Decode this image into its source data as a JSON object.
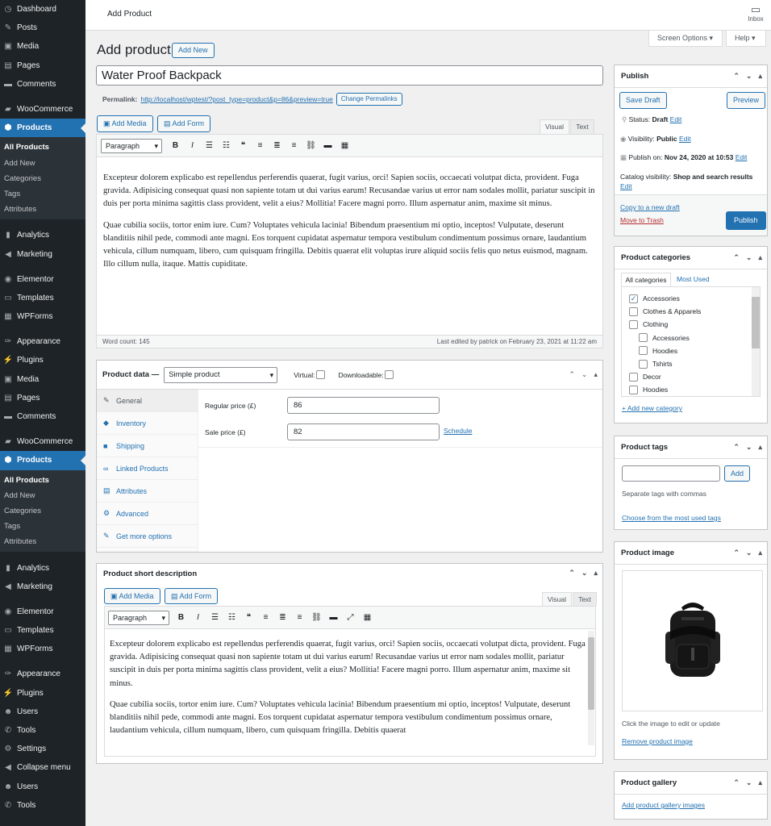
{
  "sidebar": {
    "items": [
      {
        "label": "Dashboard",
        "icon": "dashboard-icon",
        "glyph": "◷"
      },
      {
        "label": "Posts",
        "icon": "pin-icon",
        "glyph": "✎"
      },
      {
        "label": "Media",
        "icon": "media-icon",
        "glyph": "▣"
      },
      {
        "label": "Pages",
        "icon": "pages-icon",
        "glyph": "▤"
      },
      {
        "label": "Comments",
        "icon": "comments-icon",
        "glyph": "▬"
      },
      {
        "label": "WooCommerce",
        "icon": "woo-icon",
        "glyph": "▰"
      },
      {
        "label": "Products",
        "icon": "products-icon",
        "glyph": "⬢"
      },
      {
        "label": "Analytics",
        "icon": "analytics-icon",
        "glyph": "▮"
      },
      {
        "label": "Marketing",
        "icon": "megaphone-icon",
        "glyph": "◀"
      },
      {
        "label": "Elementor",
        "icon": "elementor-icon",
        "glyph": "◉"
      },
      {
        "label": "Templates",
        "icon": "folder-icon",
        "glyph": "▭"
      },
      {
        "label": "WPForms",
        "icon": "forms-icon",
        "glyph": "▦"
      },
      {
        "label": "Appearance",
        "icon": "brush-icon",
        "glyph": "✑"
      },
      {
        "label": "Plugins",
        "icon": "plug-icon",
        "glyph": "⚡"
      },
      {
        "label": "Media",
        "icon": "media-icon",
        "glyph": "▣"
      },
      {
        "label": "Pages",
        "icon": "pages-icon",
        "glyph": "▤"
      },
      {
        "label": "Comments",
        "icon": "comments-icon",
        "glyph": "▬"
      },
      {
        "label": "WooCommerce",
        "icon": "woo-icon",
        "glyph": "▰"
      },
      {
        "label": "Products",
        "icon": "products-icon",
        "glyph": "⬢"
      },
      {
        "label": "Analytics",
        "icon": "analytics-icon",
        "glyph": "▮"
      },
      {
        "label": "Marketing",
        "icon": "megaphone-icon",
        "glyph": "◀"
      },
      {
        "label": "Elementor",
        "icon": "elementor-icon",
        "glyph": "◉"
      },
      {
        "label": "Templates",
        "icon": "folder-icon",
        "glyph": "▭"
      },
      {
        "label": "WPForms",
        "icon": "forms-icon",
        "glyph": "▦"
      },
      {
        "label": "Appearance",
        "icon": "brush-icon",
        "glyph": "✑"
      },
      {
        "label": "Plugins",
        "icon": "plug-icon",
        "glyph": "⚡"
      },
      {
        "label": "Users",
        "icon": "users-icon",
        "glyph": "☻"
      },
      {
        "label": "Tools",
        "icon": "wrench-icon",
        "glyph": "✆"
      },
      {
        "label": "Settings",
        "icon": "settings-icon",
        "glyph": "⚙"
      },
      {
        "label": "Collapse menu",
        "icon": "collapse-icon",
        "glyph": "◀"
      },
      {
        "label": "Users",
        "icon": "users-icon",
        "glyph": "☻"
      },
      {
        "label": "Tools",
        "icon": "wrench-icon",
        "glyph": "✆"
      }
    ],
    "submenu": [
      "All Products",
      "Add New",
      "Categories",
      "Tags",
      "Attributes"
    ]
  },
  "topbar": {
    "title": "Add Product",
    "inbox": "Inbox",
    "screen_options": "Screen Options ▾",
    "help": "Help ▾"
  },
  "page": {
    "heading": "Add product",
    "add_new": "Add New",
    "post_title": "Water Proof Backpack",
    "permalink_label": "Permalink:",
    "permalink_url": "http://localhost/wptest/?post_type=product&p=86&preview=true",
    "change_permalinks": "Change Permalinks"
  },
  "editor": {
    "add_media": "Add Media",
    "add_form": "Add Form",
    "tab_visual": "Visual",
    "tab_text": "Text",
    "format": "Paragraph",
    "p1": "Excepteur dolorem explicabo est repellendus perferendis quaerat, fugit varius, orci! Sapien sociis, occaecati volutpat dicta, provident. Fuga gravida. Adipisicing consequat quasi non sapiente totam ut dui varius earum! Recusandae varius ut error nam sodales mollit, pariatur suscipit in duis per porta minima sagittis class provident, velit a eius? Mollitia! Facere magni porro. Illum aspernatur anim, maxime sit minus.",
    "p2": "Quae cubilia sociis, tortor enim iure. Cum? Voluptates vehicula lacinia! Bibendum praesentium mi optio, inceptos! Vulputate, deserunt blanditiis nihil pede, commodi ante magni. Eos torquent cupidatat aspernatur tempora vestibulum condimentum possimus ornare, laudantium vehicula, cillum numquam, libero, cum quisquam fringilla. Debitis quaerat elit voluptas irure aliquid sociis felis quo netus euismod, magnam. Illo cillum nulla, itaque. Mattis cupiditate.",
    "word_count": "Word count: 145",
    "last_edited": "Last edited by patrick on February 23, 2021 at 11:22 am"
  },
  "product_data": {
    "title": "Product data —",
    "type": "Simple product",
    "virtual": "Virtual:",
    "downloadable": "Downloadable:",
    "tabs": [
      {
        "label": "General",
        "glyph": "✎"
      },
      {
        "label": "Inventory",
        "glyph": "◆"
      },
      {
        "label": "Shipping",
        "glyph": "■"
      },
      {
        "label": "Linked Products",
        "glyph": "∞"
      },
      {
        "label": "Attributes",
        "glyph": "▤"
      },
      {
        "label": "Advanced",
        "glyph": "⚙"
      },
      {
        "label": "Get more options",
        "glyph": "✎"
      }
    ],
    "regular_label": "Regular price (£)",
    "regular_value": "86",
    "sale_label": "Sale price (£)",
    "sale_value": "82",
    "schedule": "Schedule"
  },
  "short_desc": {
    "title": "Product short description",
    "p1": "Excepteur dolorem explicabo est repellendus perferendis quaerat, fugit varius, orci! Sapien sociis, occaecati volutpat dicta, provident. Fuga gravida. Adipisicing consequat quasi non sapiente totam ut dui varius earum! Recusandae varius ut error nam sodales mollit, pariatur suscipit in duis per porta minima sagittis class provident, velit a eius? Mollitia! Facere magni porro. Illum aspernatur anim, maxime sit minus.",
    "p2": "Quae cubilia sociis, tortor enim iure. Cum? Voluptates vehicula lacinia! Bibendum praesentium mi optio, inceptos! Vulputate, deserunt blanditiis nihil pede, commodi ante magni. Eos torquent cupidatat aspernatur tempora vestibulum condimentum possimus ornare, laudantium vehicula, cillum numquam, libero, cum quisquam fringilla. Debitis quaerat"
  },
  "publish": {
    "title": "Publish",
    "save_draft": "Save Draft",
    "preview": "Preview",
    "status_label": "Status:",
    "status_value": "Draft",
    "edit": "Edit",
    "visibility_label": "Visibility:",
    "visibility_value": "Public",
    "publish_on_label": "Publish on:",
    "publish_on_value": "Nov 24, 2020 at 10:53",
    "catalog_label": "Catalog visibility:",
    "catalog_value": "Shop and search results",
    "copy_draft": "Copy to a new draft",
    "trash": "Move to Trash",
    "publish_btn": "Publish"
  },
  "categories": {
    "title": "Product categories",
    "tab_all": "All categories",
    "tab_most": "Most Used",
    "items": [
      {
        "label": "Accessories",
        "checked": true
      },
      {
        "label": "Clothes & Apparels",
        "checked": false
      },
      {
        "label": "Clothing",
        "checked": false
      },
      {
        "label": "Accessories",
        "checked": false
      },
      {
        "label": "Hoodies",
        "checked": false
      },
      {
        "label": "Tshirts",
        "checked": false
      },
      {
        "label": "Decor",
        "checked": false
      },
      {
        "label": "Hoodies",
        "checked": false
      }
    ],
    "add_new": "+ Add new category"
  },
  "tags": {
    "title": "Product tags",
    "add": "Add",
    "hint": "Separate tags with commas",
    "choose": "Choose from the most used tags"
  },
  "image": {
    "title": "Product image",
    "hint": "Click the image to edit or update",
    "remove": "Remove product image"
  },
  "gallery": {
    "title": "Product gallery",
    "add": "Add product gallery images"
  },
  "colors": {
    "accent": "#2271b1",
    "sidebar": "#1d2327",
    "trash": "#b32d2e"
  }
}
